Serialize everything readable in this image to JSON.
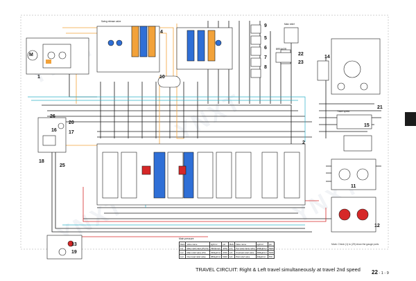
{
  "caption": "TRAVEL  CIRCUIT: Right & Left travel simultaneously at travel 2nd speed",
  "page_number": "22",
  "page_suffix": " - 1 - 9",
  "watermark": "YNXT",
  "callouts": [
    "1",
    "2",
    "4",
    "5",
    "6",
    "7",
    "8",
    "9",
    "10",
    "11",
    "12",
    "13",
    "14",
    "15",
    "16",
    "17",
    "18",
    "19",
    "20",
    "21",
    "22",
    "23",
    "25",
    "26"
  ],
  "component_labels": {
    "motor": "M",
    "selector_top": "Swing release valve",
    "breaker": "BREAKER",
    "cut_solenoid": "Main relief",
    "travel_speed": "Travel speed"
  },
  "spec_table": {
    "title": "Main pressure",
    "headers": [
      "Mark",
      "Valve name",
      "kgf/cm²",
      "psi",
      "Mark",
      "Valve name",
      "kgf/cm²",
      "psi"
    ],
    "rows": [
      [
        "A-1",
        "Main relief valve (P1,P2)",
        "330(boost)",
        "4700",
        "A-4",
        "Port load check valve",
        "380kgf/cm²",
        "5400"
      ],
      [
        "A-2",
        "Main relief valve (P3)",
        "330kgf/cm²",
        "4700",
        "A-5",
        "Overload relief valve",
        "380kgf/cm²",
        "5400"
      ],
      [
        "A-3",
        "Over-load relief valve",
        "380kgf/cm²",
        "5400",
        "A-6",
        "Pilot relief valve",
        "40kgf/cm²",
        "570"
      ]
    ]
  },
  "note": "Mark: Check (1) to (29) show the gauge ports",
  "colors": {
    "pressure": "#d62828",
    "pilot": "#f2a23a",
    "return": "#2f6fd6",
    "drain": "#2bb0c9",
    "line": "#1a1a1a",
    "accent": "#1b1b1b"
  }
}
